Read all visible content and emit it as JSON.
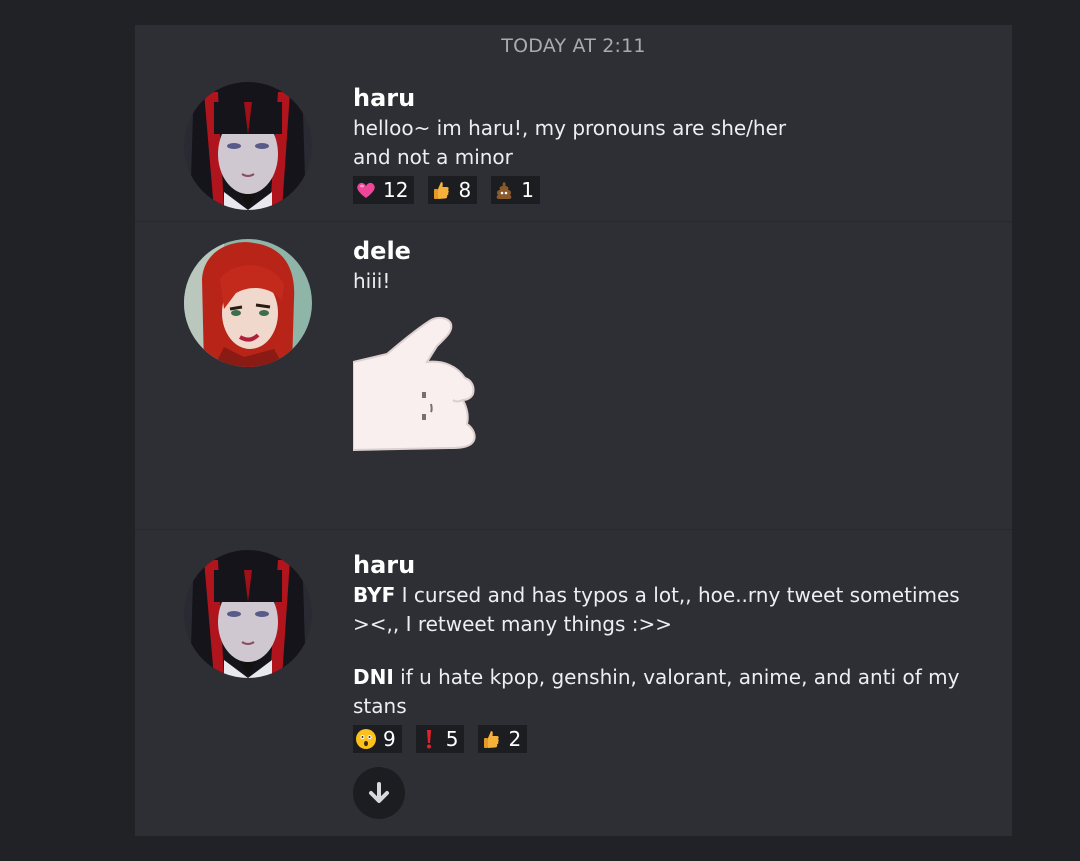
{
  "divider": "TODAY AT 2:11",
  "messages": [
    {
      "username": "haru",
      "lines": [
        "helloo~ im haru!, my pronouns are she/her",
        "and not a minor"
      ],
      "reactions": [
        {
          "icon": "pink-heart-icon",
          "count": "12"
        },
        {
          "icon": "thumbs-up-icon",
          "count": "8"
        },
        {
          "icon": "poop-icon",
          "count": "1"
        }
      ]
    },
    {
      "username": "dele",
      "text": "hiii!",
      "sticker": "pointing-hand-sticker"
    },
    {
      "username": "haru",
      "p1_bold": "BYF",
      "p1_line1": " I cursed and has typos a lot,, hoe..rny tweet sometimes",
      "p1_line2": "><,, I retweet many things :>>",
      "p2_bold": "DNI",
      "p2_line1": " if u hate kpop, genshin, valorant, anime, and anti of my",
      "p2_line2": "stans",
      "reactions": [
        {
          "icon": "astonished-face-icon",
          "count": "9"
        },
        {
          "icon": "exclamation-icon",
          "count": "5"
        },
        {
          "icon": "thumbs-up-icon",
          "count": "2"
        }
      ]
    }
  ],
  "scroll_button_icon": "arrow-down-icon",
  "colors": {
    "panel": "#2e2f34",
    "background": "#212226",
    "reaction_bg": "#1c1d21"
  }
}
